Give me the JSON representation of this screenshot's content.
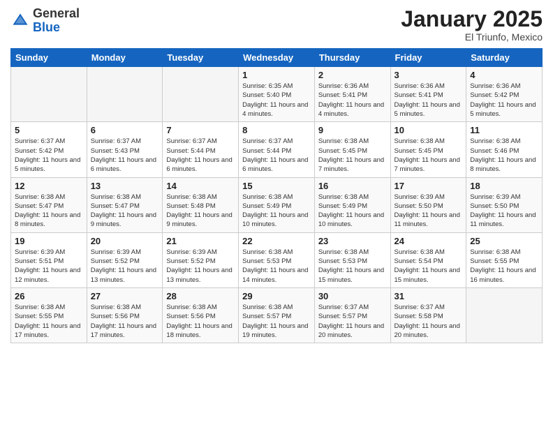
{
  "header": {
    "logo_line1": "General",
    "logo_line2": "Blue",
    "month": "January 2025",
    "location": "El Triunfo, Mexico"
  },
  "weekdays": [
    "Sunday",
    "Monday",
    "Tuesday",
    "Wednesday",
    "Thursday",
    "Friday",
    "Saturday"
  ],
  "weeks": [
    [
      {
        "day": "",
        "info": ""
      },
      {
        "day": "",
        "info": ""
      },
      {
        "day": "",
        "info": ""
      },
      {
        "day": "1",
        "info": "Sunrise: 6:35 AM\nSunset: 5:40 PM\nDaylight: 11 hours\nand 4 minutes."
      },
      {
        "day": "2",
        "info": "Sunrise: 6:36 AM\nSunset: 5:41 PM\nDaylight: 11 hours\nand 4 minutes."
      },
      {
        "day": "3",
        "info": "Sunrise: 6:36 AM\nSunset: 5:41 PM\nDaylight: 11 hours\nand 5 minutes."
      },
      {
        "day": "4",
        "info": "Sunrise: 6:36 AM\nSunset: 5:42 PM\nDaylight: 11 hours\nand 5 minutes."
      }
    ],
    [
      {
        "day": "5",
        "info": "Sunrise: 6:37 AM\nSunset: 5:42 PM\nDaylight: 11 hours\nand 5 minutes."
      },
      {
        "day": "6",
        "info": "Sunrise: 6:37 AM\nSunset: 5:43 PM\nDaylight: 11 hours\nand 6 minutes."
      },
      {
        "day": "7",
        "info": "Sunrise: 6:37 AM\nSunset: 5:44 PM\nDaylight: 11 hours\nand 6 minutes."
      },
      {
        "day": "8",
        "info": "Sunrise: 6:37 AM\nSunset: 5:44 PM\nDaylight: 11 hours\nand 6 minutes."
      },
      {
        "day": "9",
        "info": "Sunrise: 6:38 AM\nSunset: 5:45 PM\nDaylight: 11 hours\nand 7 minutes."
      },
      {
        "day": "10",
        "info": "Sunrise: 6:38 AM\nSunset: 5:45 PM\nDaylight: 11 hours\nand 7 minutes."
      },
      {
        "day": "11",
        "info": "Sunrise: 6:38 AM\nSunset: 5:46 PM\nDaylight: 11 hours\nand 8 minutes."
      }
    ],
    [
      {
        "day": "12",
        "info": "Sunrise: 6:38 AM\nSunset: 5:47 PM\nDaylight: 11 hours\nand 8 minutes."
      },
      {
        "day": "13",
        "info": "Sunrise: 6:38 AM\nSunset: 5:47 PM\nDaylight: 11 hours\nand 9 minutes."
      },
      {
        "day": "14",
        "info": "Sunrise: 6:38 AM\nSunset: 5:48 PM\nDaylight: 11 hours\nand 9 minutes."
      },
      {
        "day": "15",
        "info": "Sunrise: 6:38 AM\nSunset: 5:49 PM\nDaylight: 11 hours\nand 10 minutes."
      },
      {
        "day": "16",
        "info": "Sunrise: 6:38 AM\nSunset: 5:49 PM\nDaylight: 11 hours\nand 10 minutes."
      },
      {
        "day": "17",
        "info": "Sunrise: 6:39 AM\nSunset: 5:50 PM\nDaylight: 11 hours\nand 11 minutes."
      },
      {
        "day": "18",
        "info": "Sunrise: 6:39 AM\nSunset: 5:50 PM\nDaylight: 11 hours\nand 11 minutes."
      }
    ],
    [
      {
        "day": "19",
        "info": "Sunrise: 6:39 AM\nSunset: 5:51 PM\nDaylight: 11 hours\nand 12 minutes."
      },
      {
        "day": "20",
        "info": "Sunrise: 6:39 AM\nSunset: 5:52 PM\nDaylight: 11 hours\nand 13 minutes."
      },
      {
        "day": "21",
        "info": "Sunrise: 6:39 AM\nSunset: 5:52 PM\nDaylight: 11 hours\nand 13 minutes."
      },
      {
        "day": "22",
        "info": "Sunrise: 6:38 AM\nSunset: 5:53 PM\nDaylight: 11 hours\nand 14 minutes."
      },
      {
        "day": "23",
        "info": "Sunrise: 6:38 AM\nSunset: 5:53 PM\nDaylight: 11 hours\nand 15 minutes."
      },
      {
        "day": "24",
        "info": "Sunrise: 6:38 AM\nSunset: 5:54 PM\nDaylight: 11 hours\nand 15 minutes."
      },
      {
        "day": "25",
        "info": "Sunrise: 6:38 AM\nSunset: 5:55 PM\nDaylight: 11 hours\nand 16 minutes."
      }
    ],
    [
      {
        "day": "26",
        "info": "Sunrise: 6:38 AM\nSunset: 5:55 PM\nDaylight: 11 hours\nand 17 minutes."
      },
      {
        "day": "27",
        "info": "Sunrise: 6:38 AM\nSunset: 5:56 PM\nDaylight: 11 hours\nand 17 minutes."
      },
      {
        "day": "28",
        "info": "Sunrise: 6:38 AM\nSunset: 5:56 PM\nDaylight: 11 hours\nand 18 minutes."
      },
      {
        "day": "29",
        "info": "Sunrise: 6:38 AM\nSunset: 5:57 PM\nDaylight: 11 hours\nand 19 minutes."
      },
      {
        "day": "30",
        "info": "Sunrise: 6:37 AM\nSunset: 5:57 PM\nDaylight: 11 hours\nand 20 minutes."
      },
      {
        "day": "31",
        "info": "Sunrise: 6:37 AM\nSunset: 5:58 PM\nDaylight: 11 hours\nand 20 minutes."
      },
      {
        "day": "",
        "info": ""
      }
    ]
  ]
}
